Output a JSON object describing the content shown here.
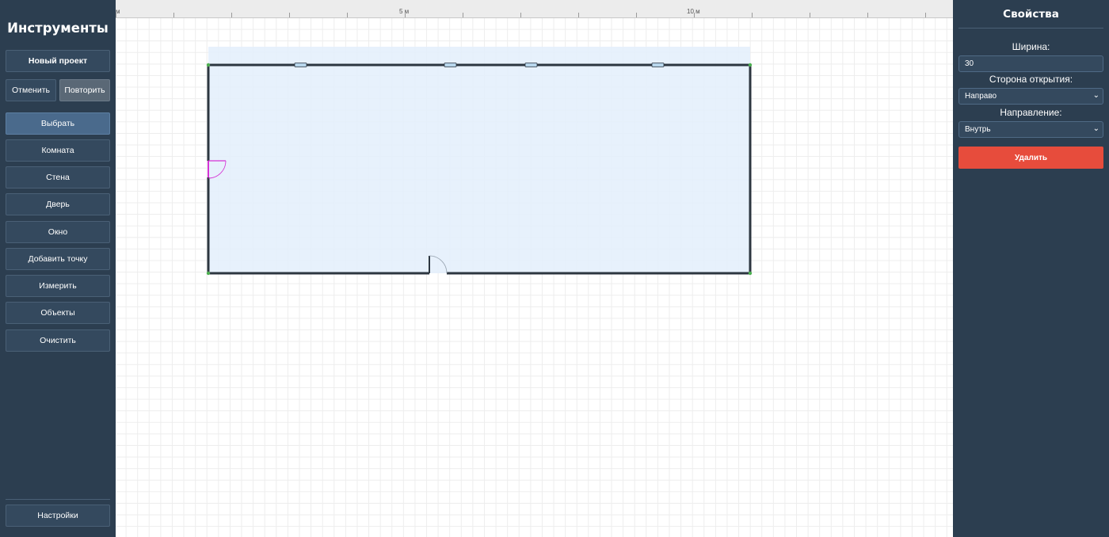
{
  "sidebar": {
    "title": "Инструменты",
    "new_project": "Новый проект",
    "undo": "Отменить",
    "redo": "Повторить",
    "tools": [
      {
        "label": "Выбрать",
        "active": true
      },
      {
        "label": "Комната"
      },
      {
        "label": "Стена"
      },
      {
        "label": "Дверь"
      },
      {
        "label": "Окно"
      },
      {
        "label": "Добавить точку"
      },
      {
        "label": "Измерить"
      },
      {
        "label": "Объекты"
      },
      {
        "label": "Очистить"
      }
    ],
    "settings": "Настройки"
  },
  "ruler": {
    "start_label": "м",
    "mark_5": "5 м",
    "mark_10": "10 м"
  },
  "properties": {
    "title": "Свойства",
    "width_label": "Ширина:",
    "width_value": "30",
    "side_label": "Сторона открытия:",
    "side_value": "Направо",
    "direction_label": "Направление:",
    "direction_value": "Внутрь",
    "delete_label": "Удалить"
  },
  "colors": {
    "panel_bg": "#2c3e50",
    "room_fill": "#e3eefc",
    "wall": "#2c3640",
    "selected_door": "#d633d6",
    "delete": "#e74c3c",
    "vertex": "#4caf50"
  },
  "icons": {
    "select_chevron": "chevron-down-icon"
  }
}
